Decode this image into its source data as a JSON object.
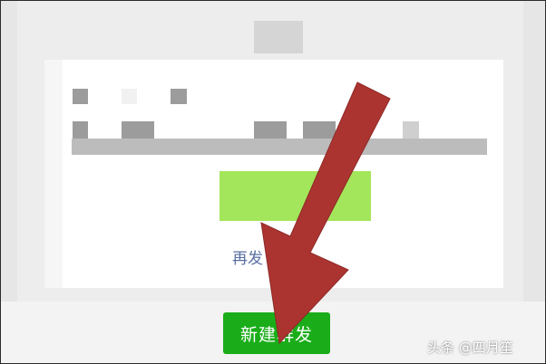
{
  "dialog": {
    "secondary_link_partial": "再发",
    "green_button_label": ""
  },
  "footer": {
    "new_group_button": "新建群发"
  },
  "watermark": {
    "text": "头条 @四月笙"
  },
  "annotation": {
    "arrow_icon": "red-arrow-icon",
    "arrow_color": "#ab3431"
  },
  "colors": {
    "accent_green": "#1aad19",
    "light_green": "#a3e65b",
    "link_blue": "#5a6fa2"
  }
}
